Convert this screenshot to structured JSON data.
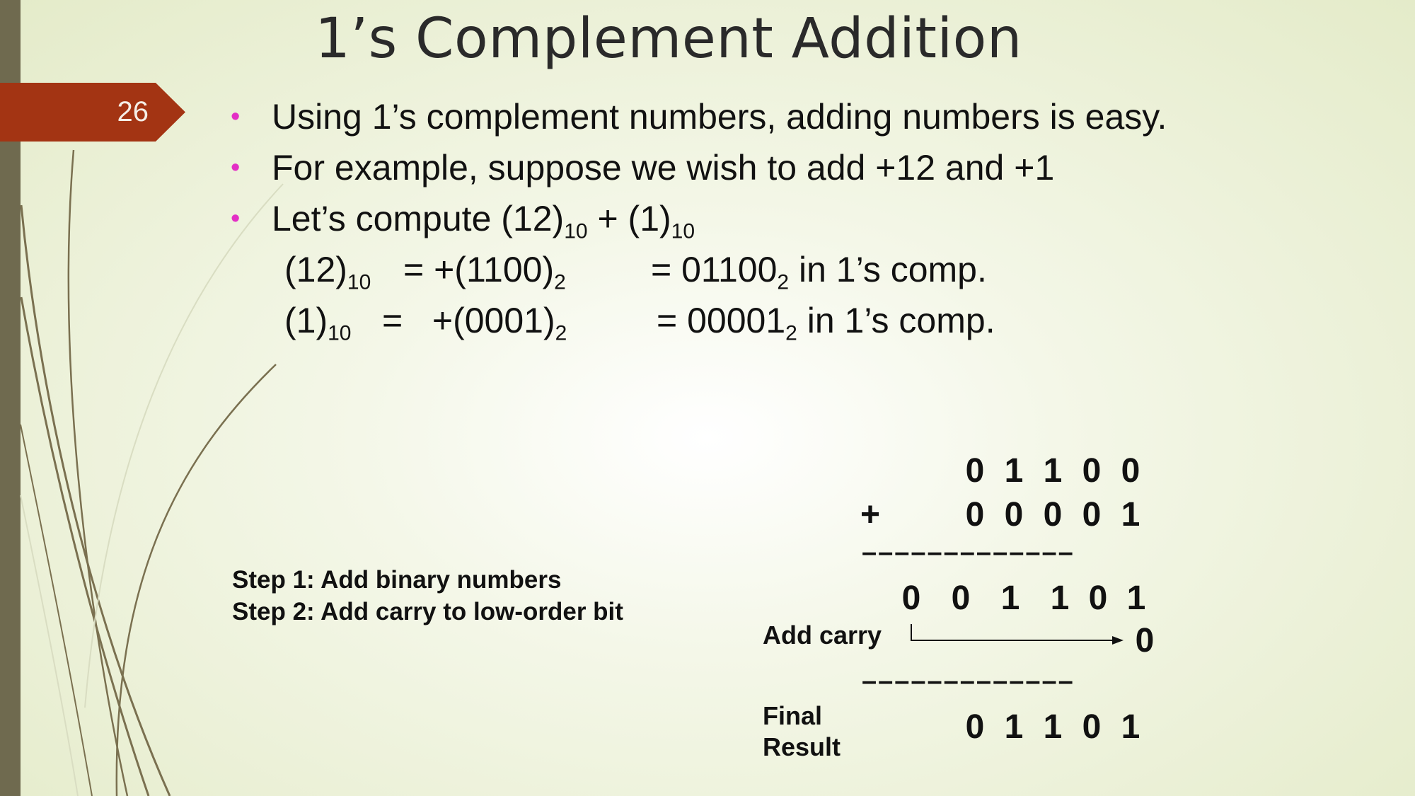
{
  "slide": {
    "title": "1’s Complement Addition",
    "page_number": "26",
    "bullets": [
      {
        "text": "Using 1’s complement numbers, adding numbers is easy."
      },
      {
        "text": "For example, suppose we wish to add +12 and +1"
      },
      {
        "pre": "Let’s compute (12)",
        "sub1": "10",
        "mid": " + (1)",
        "sub2": "10"
      }
    ],
    "equations": [
      {
        "lhs": "(12)",
        "lhs_sub": "10",
        "eq1": "= +(1100)",
        "eq1_sub": "2",
        "eq2": "= 01100",
        "eq2_sub": "2",
        "tail": " in 1’s comp."
      },
      {
        "lhs": "(1)",
        "lhs_sub": "10",
        "eq1": "=   +(0001)",
        "eq1_sub": "2",
        "eq2": "= 00001",
        "eq2_sub": "2",
        "tail": " in 1’s comp."
      }
    ],
    "steps": [
      "Step 1:  Add binary numbers",
      "Step 2: Add carry to low-order bit"
    ],
    "addition": {
      "operand1": [
        "0",
        "1",
        "1",
        "0",
        "0"
      ],
      "plus_sign": "+",
      "operand2": [
        "0",
        "0",
        "0",
        "0",
        "1"
      ],
      "divider": "–––––––––––––",
      "sum": [
        "0",
        "0",
        "1",
        "1",
        "0",
        "1"
      ],
      "carry_label": "Add carry",
      "carry_value": "0",
      "final_label_line1": "Final",
      "final_label_line2": "Result",
      "result": [
        "0",
        "1",
        "1",
        "0",
        "1"
      ]
    },
    "colors": {
      "accent_tab": "#a33413",
      "bullet": "#e32fc5",
      "side_bar": "#6f6a4f"
    }
  }
}
